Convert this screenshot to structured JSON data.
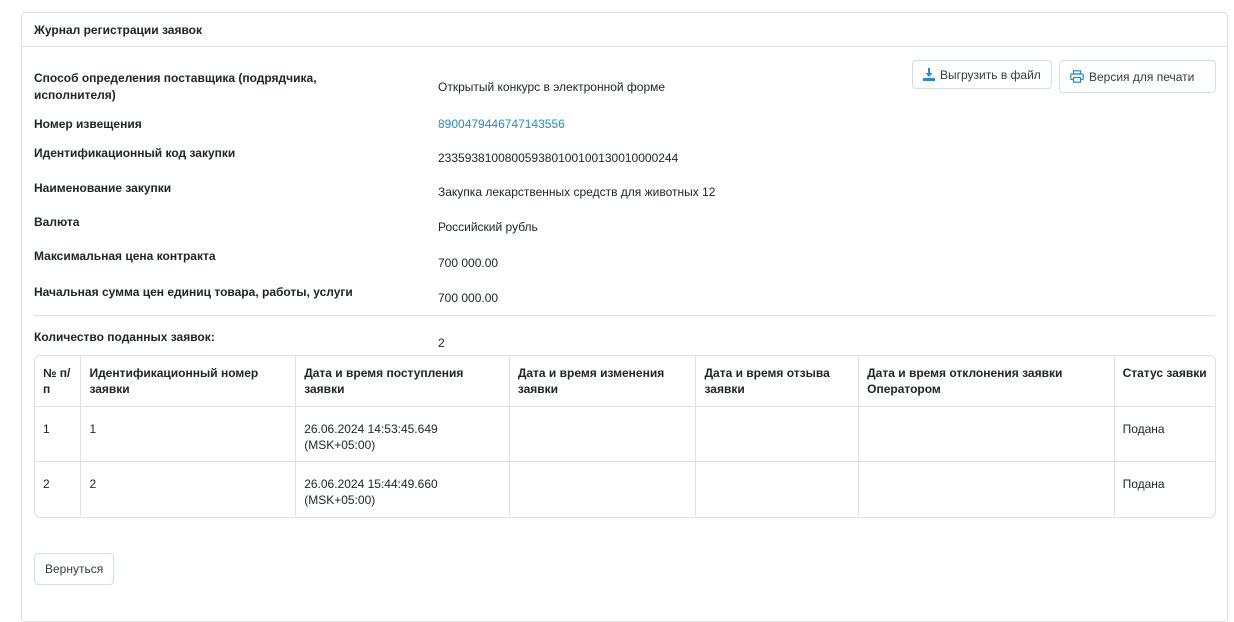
{
  "panel": {
    "title": "Журнал регистрации заявок"
  },
  "info": [
    {
      "label": "Способ определения поставщика (подрядчика, исполнителя)",
      "value": "Открытый конкурс в электронной форме",
      "link": false
    },
    {
      "label": "Номер извещения",
      "value": "8900479446747143556",
      "link": true
    },
    {
      "label": "Идентификационный код закупки",
      "value": "233593810080059380100100130010000244",
      "link": false
    },
    {
      "label": "Наименование закупки",
      "value": "Закупка лекарственных средств для животных 12",
      "link": false
    },
    {
      "label": "Валюта",
      "value": "Российский рубль",
      "link": false
    },
    {
      "label": "Максимальная цена контракта",
      "value": "700 000.00",
      "link": false
    },
    {
      "label": "Начальная сумма цен единиц товара, работы, услуги",
      "value": "700 000.00",
      "link": false
    }
  ],
  "count": {
    "label": "Количество поданных заявок:",
    "value": "2"
  },
  "buttons": {
    "export": "Выгрузить в файл",
    "print": "Версия для печати",
    "back": "Вернуться"
  },
  "icons": {
    "export": "download-icon",
    "print": "printer-icon"
  },
  "colors": {
    "link": "#2a8bc0",
    "export_icon": "#2a8bc0",
    "border": "#dee2e6"
  },
  "table": {
    "headers": [
      "№ п/п",
      "Идентификационный номер заявки",
      "Дата и время поступления заявки",
      "Дата и время изменения заявки",
      "Дата и время отзыва заявки",
      "Дата и время отклонения заявки Оператором",
      "Статус заявки"
    ],
    "rows": [
      [
        "1",
        "1",
        "26.06.2024 14:53:45.649 (MSK+05:00)",
        "",
        "",
        "",
        "Подана"
      ],
      [
        "2",
        "2",
        "26.06.2024 15:44:49.660 (MSK+05:00)",
        "",
        "",
        "",
        "Подана"
      ]
    ]
  }
}
